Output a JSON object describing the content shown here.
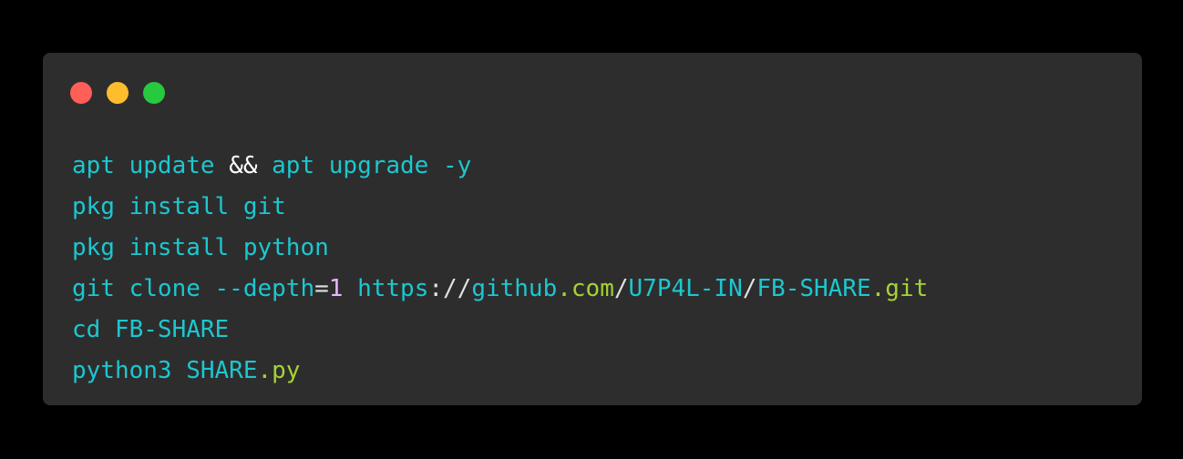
{
  "colors": {
    "background": "#000000",
    "window": "#2d2d2d",
    "dot_close": "#ff5f56",
    "dot_minimize": "#ffbd2e",
    "dot_maximize": "#27c93f",
    "command": "#1cc7d0",
    "operator": "#ffffff",
    "number": "#e9b6ff",
    "punct": "#e0e0e0",
    "highlight": "#a6d233"
  },
  "window_controls": {
    "close_icon": "red-dot-icon",
    "minimize_icon": "yellow-dot-icon",
    "maximize_icon": "green-dot-icon"
  },
  "code_lines": [
    [
      {
        "text": "apt update ",
        "role": "command"
      },
      {
        "text": "&&",
        "role": "operator"
      },
      {
        "text": " apt upgrade -y",
        "role": "command"
      }
    ],
    [
      {
        "text": "pkg install git",
        "role": "command"
      }
    ],
    [
      {
        "text": "pkg install python",
        "role": "command"
      }
    ],
    [
      {
        "text": "git clone --depth",
        "role": "command"
      },
      {
        "text": "=",
        "role": "punct"
      },
      {
        "text": "1",
        "role": "number"
      },
      {
        "text": " https",
        "role": "command"
      },
      {
        "text": "://",
        "role": "punct"
      },
      {
        "text": "github",
        "role": "command"
      },
      {
        "text": ".com",
        "role": "highlight"
      },
      {
        "text": "/",
        "role": "punct"
      },
      {
        "text": "U7P4L-IN",
        "role": "command"
      },
      {
        "text": "/",
        "role": "punct"
      },
      {
        "text": "FB-SHARE",
        "role": "command"
      },
      {
        "text": ".git",
        "role": "highlight"
      }
    ],
    [
      {
        "text": "cd FB-SHARE",
        "role": "command"
      }
    ],
    [
      {
        "text": "python3 SHARE",
        "role": "command"
      },
      {
        "text": ".py",
        "role": "highlight"
      }
    ]
  ]
}
